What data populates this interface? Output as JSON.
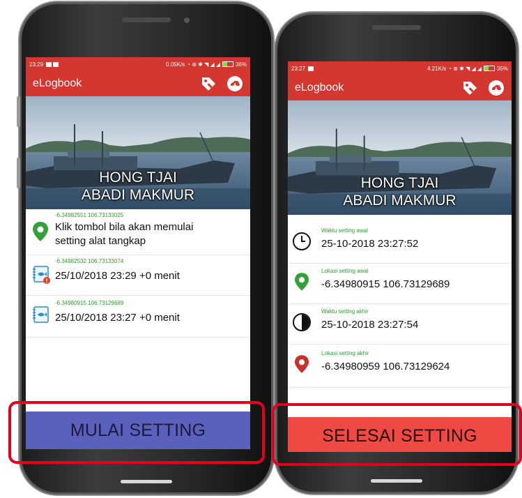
{
  "phone_left": {
    "status": {
      "time": "23:29",
      "right": "0.05K/s",
      "battery": "36%"
    },
    "app_title": "eLogbook",
    "boat_name_line1": "HONG TJAI",
    "boat_name_line2": "ABADI MAKMUR",
    "entries": [
      {
        "coords": "-6.34982551 106.73133025",
        "text_line1": "Klik tombol bila akan memulai",
        "text_line2": "setting alat tangkap",
        "icon": "location-pin-icon"
      },
      {
        "coords": "-6.34982532 106.73133074",
        "text_line1": "25/10/2018 23:29 +0 menit",
        "icon": "fishing-log-alert-icon"
      },
      {
        "coords": "-6.34980915 106.73129689",
        "text_line1": "25/10/2018 23:27 +0 menit",
        "icon": "fishing-log-icon"
      }
    ],
    "button_label": "MULAI SETTING",
    "button_color": "#5a61bd"
  },
  "phone_right": {
    "status": {
      "time": "23:27",
      "right": "4.21K/s",
      "battery": "35%"
    },
    "app_title": "eLogbook",
    "boat_name_line1": "HONG TJAI",
    "boat_name_line2": "ABADI MAKMUR",
    "entries": [
      {
        "label": "Waktu setting awal",
        "value": "25-10-2018 23:27:52",
        "icon": "clock-icon"
      },
      {
        "label": "Lokasi setting awal",
        "value": "-6.34980915 106.73129689",
        "icon": "location-pin-green-icon"
      },
      {
        "label": "Waktu setting akhir",
        "value": "25-10-2018 23:27:54",
        "icon": "clock-filled-icon"
      },
      {
        "label": "Lokasi setting akhir",
        "value": "-6.34980959 106.73129624",
        "icon": "location-pin-red-icon"
      }
    ],
    "button_label": "SELESAI SETTING",
    "button_color": "#ee4a43"
  },
  "colors": {
    "accent": "#d4372f",
    "highlight_border": "#e4001c",
    "coords_text": "#2e9d2e"
  }
}
